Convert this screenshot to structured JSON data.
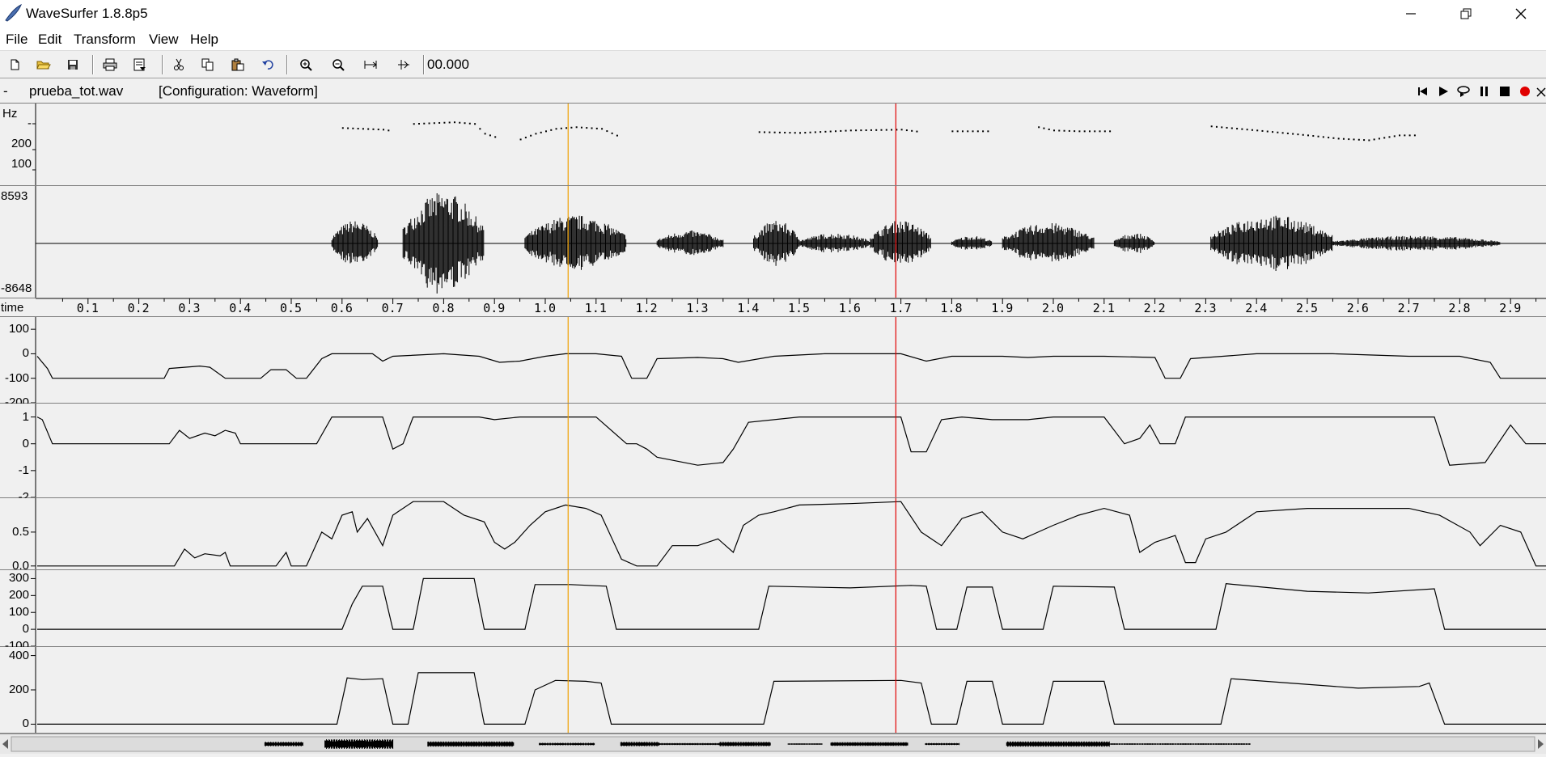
{
  "window": {
    "title": "WaveSurfer 1.8.8p5",
    "minimize_glyph": "—",
    "restore_glyph": "❐",
    "close_glyph": "✕"
  },
  "menu": [
    "File",
    "Edit",
    "Transform",
    "View",
    "Help"
  ],
  "toolbar": {
    "icons": [
      "new-file-icon",
      "open-folder-icon",
      "save-icon",
      "print-icon",
      "properties-icon",
      "cut-icon",
      "copy-icon",
      "paste-icon",
      "undo-icon",
      "zoom-in-icon",
      "zoom-out-icon",
      "zoom-fit-icon",
      "zoom-selection-icon"
    ],
    "time": "00.000"
  },
  "sound": {
    "dash": "-",
    "filename": "prueba_tot.wav",
    "configuration": "[Configuration: Waveform]",
    "controls": [
      "rewind-icon",
      "play-icon",
      "play-loop-icon",
      "pause-icon",
      "stop-icon",
      "record-icon",
      "close-icon"
    ]
  },
  "colors": {
    "cursor": "#f0a000",
    "playmark": "#e00000",
    "trace": "#000000",
    "background": "#f0f0f0"
  },
  "cursor_time": 1.045,
  "playmark_time": 1.69,
  "panels": {
    "pitch": {
      "unit": "Hz",
      "ticks": [
        "-",
        "200",
        "100"
      ],
      "segments": [
        [
          [
            0.6,
            0.71
          ],
          [
            0.64,
            0.7
          ],
          [
            0.68,
            0.69
          ],
          [
            0.7,
            0.67
          ]
        ],
        [
          [
            0.74,
            0.76
          ],
          [
            0.78,
            0.77
          ],
          [
            0.82,
            0.78
          ],
          [
            0.86,
            0.76
          ],
          [
            0.88,
            0.64
          ],
          [
            0.91,
            0.58
          ]
        ],
        [
          [
            0.95,
            0.57
          ],
          [
            0.98,
            0.64
          ],
          [
            1.02,
            0.7
          ],
          [
            1.06,
            0.72
          ],
          [
            1.11,
            0.7
          ],
          [
            1.15,
            0.59
          ]
        ],
        [
          [
            1.42,
            0.66
          ],
          [
            1.5,
            0.65
          ],
          [
            1.6,
            0.68
          ],
          [
            1.7,
            0.69
          ],
          [
            1.74,
            0.66
          ]
        ],
        [
          [
            1.8,
            0.67
          ],
          [
            1.88,
            0.67
          ]
        ],
        [
          [
            1.97,
            0.72
          ],
          [
            2.0,
            0.68
          ],
          [
            2.05,
            0.67
          ],
          [
            2.12,
            0.67
          ]
        ],
        [
          [
            2.31,
            0.73
          ],
          [
            2.4,
            0.68
          ],
          [
            2.5,
            0.62
          ],
          [
            2.56,
            0.58
          ],
          [
            2.62,
            0.56
          ],
          [
            2.68,
            0.62
          ],
          [
            2.72,
            0.62
          ]
        ]
      ]
    },
    "waveform": {
      "max": "8593",
      "min": "-8648",
      "segments": [
        {
          "start": 0.58,
          "end": 0.67,
          "amp": 0.45
        },
        {
          "start": 0.72,
          "end": 0.88,
          "amp": 1.0
        },
        {
          "start": 0.96,
          "end": 1.16,
          "amp": 0.55
        },
        {
          "start": 1.22,
          "end": 1.35,
          "amp": 0.25
        },
        {
          "start": 1.41,
          "end": 1.5,
          "amp": 0.45
        },
        {
          "start": 1.5,
          "end": 1.64,
          "amp": 0.2
        },
        {
          "start": 1.64,
          "end": 1.76,
          "amp": 0.45
        },
        {
          "start": 1.8,
          "end": 1.88,
          "amp": 0.15
        },
        {
          "start": 1.9,
          "end": 2.08,
          "amp": 0.4
        },
        {
          "start": 2.12,
          "end": 2.2,
          "amp": 0.2
        },
        {
          "start": 2.31,
          "end": 2.55,
          "amp": 0.55
        },
        {
          "start": 2.55,
          "end": 2.88,
          "amp": 0.15
        }
      ]
    },
    "time_axis": {
      "label": "time",
      "ticks": [
        "0.1",
        "0.2",
        "0.3",
        "0.4",
        "0.5",
        "0.6",
        "0.7",
        "0.8",
        "0.9",
        "1.0",
        "1.1",
        "1.2",
        "1.3",
        "1.4",
        "1.5",
        "1.6",
        "1.7",
        "1.8",
        "1.9",
        "2.0",
        "2.1",
        "2.2",
        "2.3",
        "2.4",
        "2.5",
        "2.6",
        "2.7",
        "2.8",
        "2.9"
      ],
      "tick_values": [
        0.1,
        0.2,
        0.3,
        0.4,
        0.5,
        0.6,
        0.7,
        0.8,
        0.9,
        1.0,
        1.1,
        1.2,
        1.3,
        1.4,
        1.5,
        1.6,
        1.7,
        1.8,
        1.9,
        2.0,
        2.1,
        2.2,
        2.3,
        2.4,
        2.5,
        2.6,
        2.7,
        2.8,
        2.9
      ]
    },
    "trace1": {
      "ticks": [
        "100",
        "0",
        "-100",
        "-200"
      ],
      "range": [
        -200,
        150
      ],
      "points": [
        [
          0,
          -10
        ],
        [
          0.02,
          -60
        ],
        [
          0.03,
          -100
        ],
        [
          0.25,
          -100
        ],
        [
          0.26,
          -60
        ],
        [
          0.32,
          -50
        ],
        [
          0.34,
          -55
        ],
        [
          0.37,
          -100
        ],
        [
          0.44,
          -100
        ],
        [
          0.46,
          -65
        ],
        [
          0.49,
          -65
        ],
        [
          0.51,
          -100
        ],
        [
          0.53,
          -100
        ],
        [
          0.56,
          -20
        ],
        [
          0.58,
          0
        ],
        [
          0.66,
          0
        ],
        [
          0.68,
          -30
        ],
        [
          0.7,
          -10
        ],
        [
          0.8,
          0
        ],
        [
          0.87,
          -10
        ],
        [
          0.91,
          -35
        ],
        [
          0.95,
          -30
        ],
        [
          1.0,
          -10
        ],
        [
          1.04,
          0
        ],
        [
          1.1,
          0
        ],
        [
          1.15,
          -10
        ],
        [
          1.17,
          -100
        ],
        [
          1.2,
          -100
        ],
        [
          1.22,
          -20
        ],
        [
          1.3,
          -15
        ],
        [
          1.35,
          -20
        ],
        [
          1.38,
          -35
        ],
        [
          1.45,
          -10
        ],
        [
          1.55,
          0
        ],
        [
          1.7,
          0
        ],
        [
          1.75,
          -30
        ],
        [
          1.8,
          -10
        ],
        [
          1.9,
          -10
        ],
        [
          1.95,
          -15
        ],
        [
          2.0,
          -10
        ],
        [
          2.1,
          -10
        ],
        [
          2.2,
          -15
        ],
        [
          2.22,
          -100
        ],
        [
          2.25,
          -100
        ],
        [
          2.27,
          -20
        ],
        [
          2.4,
          0
        ],
        [
          2.55,
          0
        ],
        [
          2.7,
          -10
        ],
        [
          2.8,
          -10
        ],
        [
          2.86,
          -35
        ],
        [
          2.88,
          -100
        ],
        [
          2.97,
          -100
        ]
      ]
    },
    "trace2": {
      "ticks": [
        "1",
        "0",
        "-1",
        "-2"
      ],
      "range": [
        -2,
        1.5
      ],
      "points": [
        [
          0,
          1.0
        ],
        [
          0.01,
          0.9
        ],
        [
          0.03,
          0
        ],
        [
          0.26,
          0
        ],
        [
          0.28,
          0.5
        ],
        [
          0.3,
          0.2
        ],
        [
          0.33,
          0.4
        ],
        [
          0.35,
          0.3
        ],
        [
          0.37,
          0.5
        ],
        [
          0.39,
          0.4
        ],
        [
          0.4,
          0
        ],
        [
          0.55,
          0
        ],
        [
          0.58,
          1.0
        ],
        [
          0.66,
          1.0
        ],
        [
          0.68,
          1.0
        ],
        [
          0.7,
          -0.2
        ],
        [
          0.72,
          0
        ],
        [
          0.74,
          1.0
        ],
        [
          0.87,
          1.0
        ],
        [
          0.9,
          0.9
        ],
        [
          0.95,
          1.0
        ],
        [
          1.1,
          1.0
        ],
        [
          1.16,
          0
        ],
        [
          1.18,
          0
        ],
        [
          1.2,
          -0.2
        ],
        [
          1.22,
          -0.5
        ],
        [
          1.3,
          -0.8
        ],
        [
          1.35,
          -0.7
        ],
        [
          1.37,
          -0.2
        ],
        [
          1.4,
          0.8
        ],
        [
          1.5,
          1.0
        ],
        [
          1.7,
          1.0
        ],
        [
          1.72,
          -0.3
        ],
        [
          1.75,
          -0.3
        ],
        [
          1.78,
          0.9
        ],
        [
          1.82,
          1.0
        ],
        [
          1.88,
          0.9
        ],
        [
          1.95,
          0.9
        ],
        [
          2.0,
          1.0
        ],
        [
          2.1,
          1.0
        ],
        [
          2.14,
          0
        ],
        [
          2.17,
          0.2
        ],
        [
          2.19,
          0.7
        ],
        [
          2.21,
          0
        ],
        [
          2.24,
          0
        ],
        [
          2.26,
          1.0
        ],
        [
          2.4,
          1.0
        ],
        [
          2.75,
          1.0
        ],
        [
          2.78,
          -0.8
        ],
        [
          2.85,
          -0.7
        ],
        [
          2.9,
          0.7
        ],
        [
          2.93,
          0
        ],
        [
          2.97,
          0
        ]
      ]
    },
    "trace3": {
      "ticks": [
        "0.5",
        "0.0"
      ],
      "range": [
        -0.05,
        1.0
      ],
      "points": [
        [
          0,
          0
        ],
        [
          0.27,
          0
        ],
        [
          0.29,
          0.25
        ],
        [
          0.31,
          0.12
        ],
        [
          0.33,
          0.18
        ],
        [
          0.36,
          0.15
        ],
        [
          0.37,
          0.2
        ],
        [
          0.38,
          0
        ],
        [
          0.47,
          0
        ],
        [
          0.49,
          0.2
        ],
        [
          0.5,
          0
        ],
        [
          0.53,
          0
        ],
        [
          0.56,
          0.5
        ],
        [
          0.58,
          0.4
        ],
        [
          0.6,
          0.75
        ],
        [
          0.62,
          0.8
        ],
        [
          0.63,
          0.5
        ],
        [
          0.65,
          0.7
        ],
        [
          0.68,
          0.3
        ],
        [
          0.7,
          0.75
        ],
        [
          0.74,
          0.95
        ],
        [
          0.8,
          0.95
        ],
        [
          0.84,
          0.75
        ],
        [
          0.88,
          0.65
        ],
        [
          0.9,
          0.35
        ],
        [
          0.92,
          0.25
        ],
        [
          0.94,
          0.35
        ],
        [
          0.97,
          0.6
        ],
        [
          1.0,
          0.8
        ],
        [
          1.04,
          0.9
        ],
        [
          1.08,
          0.85
        ],
        [
          1.11,
          0.75
        ],
        [
          1.15,
          0.1
        ],
        [
          1.18,
          0
        ],
        [
          1.22,
          0
        ],
        [
          1.25,
          0.3
        ],
        [
          1.3,
          0.3
        ],
        [
          1.34,
          0.4
        ],
        [
          1.37,
          0.2
        ],
        [
          1.39,
          0.6
        ],
        [
          1.42,
          0.75
        ],
        [
          1.45,
          0.8
        ],
        [
          1.5,
          0.9
        ],
        [
          1.6,
          0.92
        ],
        [
          1.7,
          0.95
        ],
        [
          1.74,
          0.5
        ],
        [
          1.78,
          0.3
        ],
        [
          1.82,
          0.7
        ],
        [
          1.86,
          0.8
        ],
        [
          1.9,
          0.5
        ],
        [
          1.94,
          0.4
        ],
        [
          2.0,
          0.6
        ],
        [
          2.05,
          0.75
        ],
        [
          2.1,
          0.85
        ],
        [
          2.15,
          0.75
        ],
        [
          2.17,
          0.2
        ],
        [
          2.2,
          0.35
        ],
        [
          2.24,
          0.45
        ],
        [
          2.26,
          0.05
        ],
        [
          2.28,
          0.05
        ],
        [
          2.3,
          0.4
        ],
        [
          2.34,
          0.5
        ],
        [
          2.4,
          0.8
        ],
        [
          2.5,
          0.85
        ],
        [
          2.6,
          0.85
        ],
        [
          2.7,
          0.85
        ],
        [
          2.76,
          0.75
        ],
        [
          2.82,
          0.5
        ],
        [
          2.84,
          0.3
        ],
        [
          2.88,
          0.6
        ],
        [
          2.92,
          0.5
        ],
        [
          2.95,
          0
        ],
        [
          2.97,
          0
        ]
      ]
    },
    "trace4": {
      "ticks": [
        "300",
        "200",
        "100",
        "0",
        "-100"
      ],
      "range": [
        -100,
        350
      ],
      "points": [
        [
          0,
          0
        ],
        [
          0.6,
          0
        ],
        [
          0.62,
          150
        ],
        [
          0.64,
          255
        ],
        [
          0.68,
          255
        ],
        [
          0.7,
          0
        ],
        [
          0.74,
          0
        ],
        [
          0.76,
          300
        ],
        [
          0.84,
          300
        ],
        [
          0.86,
          300
        ],
        [
          0.88,
          0
        ],
        [
          0.96,
          0
        ],
        [
          0.98,
          265
        ],
        [
          1.05,
          265
        ],
        [
          1.12,
          255
        ],
        [
          1.14,
          0
        ],
        [
          1.42,
          0
        ],
        [
          1.44,
          255
        ],
        [
          1.6,
          245
        ],
        [
          1.72,
          260
        ],
        [
          1.75,
          255
        ],
        [
          1.77,
          0
        ],
        [
          1.81,
          0
        ],
        [
          1.83,
          250
        ],
        [
          1.88,
          250
        ],
        [
          1.9,
          0
        ],
        [
          1.98,
          0
        ],
        [
          2.0,
          255
        ],
        [
          2.12,
          250
        ],
        [
          2.14,
          0
        ],
        [
          2.32,
          0
        ],
        [
          2.34,
          270
        ],
        [
          2.5,
          225
        ],
        [
          2.62,
          215
        ],
        [
          2.75,
          240
        ],
        [
          2.77,
          0
        ],
        [
          2.97,
          0
        ]
      ]
    },
    "trace5": {
      "ticks": [
        "400",
        "200",
        "0"
      ],
      "range": [
        -50,
        450
      ],
      "points": [
        [
          0,
          0
        ],
        [
          0.59,
          0
        ],
        [
          0.61,
          270
        ],
        [
          0.64,
          260
        ],
        [
          0.68,
          265
        ],
        [
          0.7,
          0
        ],
        [
          0.73,
          0
        ],
        [
          0.75,
          300
        ],
        [
          0.86,
          300
        ],
        [
          0.88,
          0
        ],
        [
          0.96,
          0
        ],
        [
          0.98,
          200
        ],
        [
          1.02,
          255
        ],
        [
          1.08,
          250
        ],
        [
          1.11,
          240
        ],
        [
          1.13,
          0
        ],
        [
          1.43,
          0
        ],
        [
          1.45,
          250
        ],
        [
          1.7,
          255
        ],
        [
          1.74,
          240
        ],
        [
          1.76,
          0
        ],
        [
          1.81,
          0
        ],
        [
          1.83,
          250
        ],
        [
          1.88,
          250
        ],
        [
          1.9,
          0
        ],
        [
          1.98,
          0
        ],
        [
          2.0,
          250
        ],
        [
          2.1,
          250
        ],
        [
          2.12,
          0
        ],
        [
          2.33,
          0
        ],
        [
          2.35,
          265
        ],
        [
          2.6,
          210
        ],
        [
          2.72,
          220
        ],
        [
          2.74,
          240
        ],
        [
          2.77,
          0
        ],
        [
          2.97,
          0
        ]
      ]
    }
  }
}
